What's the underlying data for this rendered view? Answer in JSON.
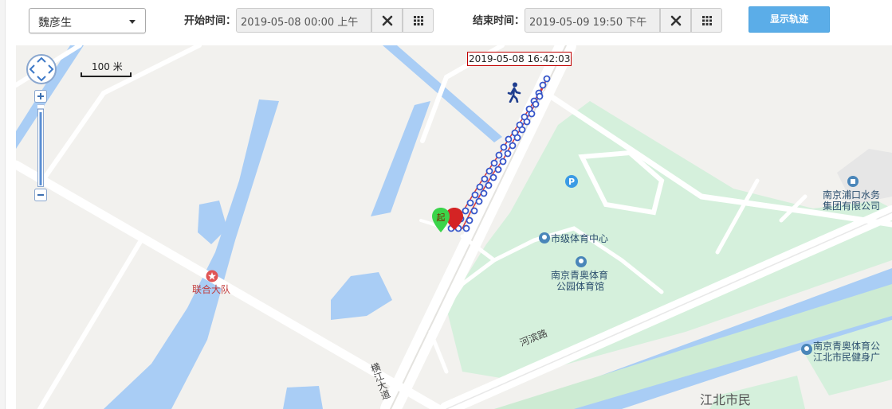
{
  "toolbar": {
    "person_select": {
      "value": "魏彦生"
    },
    "start_time": {
      "label": "开始时间：",
      "value": "2019-05-08 00:00 上午"
    },
    "end_time": {
      "label": "结束时间：",
      "value": "2019-05-09 19:50 下午"
    },
    "show_track_label": "显示轨迹"
  },
  "map": {
    "track_timestamp": "2019-05-08 16:42:03",
    "scale_label": "100 米",
    "labels": {
      "unit": "联合大队",
      "sports_center": "市级体育中心",
      "olympic_park_1": "南京青奥体育",
      "olympic_park_2": "公园体育馆",
      "water_1": "南京浦口水务",
      "water_2": "集团有限公司",
      "fitness_1": "南京青奥体育公",
      "fitness_2": "江北市民健身广",
      "jiangbei": "江北市民",
      "hebin_road": "河滨路",
      "hengjiang_ave": "横江大道",
      "start_marker": "起",
      "parking": "P"
    },
    "colors": {
      "water": "#a9cdf5",
      "green": "#d5f0dc",
      "road": "#ffffff",
      "track_points": "#3555c9",
      "track_line": "#d83a3a"
    },
    "icons": [
      "walker-icon",
      "parking-icon",
      "start-pin-icon",
      "end-pin-icon",
      "poi-icons"
    ]
  }
}
